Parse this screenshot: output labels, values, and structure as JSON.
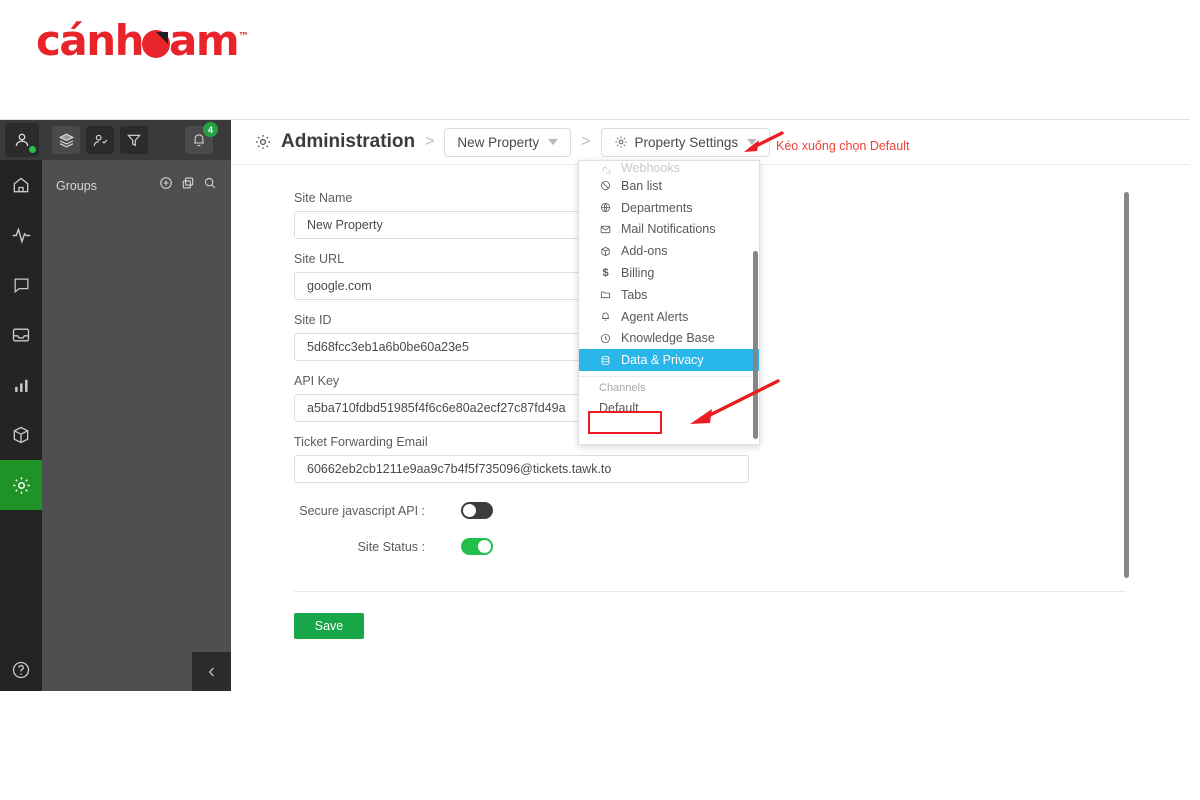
{
  "brand": {
    "text_before": "cánh",
    "text_after": "am",
    "trademark": "™"
  },
  "rail": {
    "avatar_icon": "user-avatar-icon",
    "status": "online",
    "items": [
      {
        "icon": "home-icon",
        "name": "home"
      },
      {
        "icon": "activity-icon",
        "name": "monitoring"
      },
      {
        "icon": "chat-icon",
        "name": "chats"
      },
      {
        "icon": "inbox-icon",
        "name": "inbox"
      },
      {
        "icon": "bar-chart-icon",
        "name": "reporting"
      },
      {
        "icon": "box-icon",
        "name": "shortcuts"
      },
      {
        "icon": "gear-icon",
        "name": "administration",
        "active": true
      }
    ],
    "help_icon": "help-circle-icon"
  },
  "groups": {
    "toolbar": [
      {
        "icon": "layers-icon",
        "name": "layers"
      },
      {
        "icon": "add-user-icon",
        "name": "add-user"
      },
      {
        "icon": "filter-icon",
        "name": "filter"
      }
    ],
    "bell_icon": "bell-icon",
    "bell_badge": "4",
    "title": "Groups",
    "actions": [
      {
        "icon": "plus-circle-icon",
        "name": "add-group"
      },
      {
        "icon": "copy-icon",
        "name": "duplicate"
      },
      {
        "icon": "search-icon",
        "name": "search"
      }
    ],
    "collapse_icon": "chevron-left-icon"
  },
  "breadcrumb": {
    "gear_icon": "gear-icon",
    "title": "Administration",
    "separator": ">",
    "property": "New Property",
    "settings_gear_icon": "gear-icon",
    "settings": "Property Settings"
  },
  "annotation": {
    "text": "Kéo xuống chọn Default",
    "color": "#ef4136"
  },
  "form": {
    "fields": [
      {
        "label": "Site Name",
        "value": "New  Property"
      },
      {
        "label": "Site URL",
        "value": "google.com"
      },
      {
        "label": "Site ID",
        "value": "5d68fcc3eb1a6b0be60a23e5"
      },
      {
        "label": "API Key",
        "value": "a5ba710fdbd51985f4f6c6e80a2ecf27c87fd49a"
      },
      {
        "label": "Ticket Forwarding Email",
        "value": "60662eb2cb1211e9aa9c7b4f5f735096@tickets.tawk.to"
      }
    ],
    "toggles": [
      {
        "label": "Secure javascript API :",
        "state": "off"
      },
      {
        "label": "Site Status :",
        "state": "on"
      }
    ],
    "save_label": "Save",
    "save_color": "#17a648"
  },
  "menu": {
    "items": [
      {
        "label": "Webhooks",
        "icon": "webhook-icon",
        "clipped": true
      },
      {
        "label": "Ban list",
        "icon": "ban-icon"
      },
      {
        "label": "Departments",
        "icon": "globe-icon"
      },
      {
        "label": "Mail Notifications",
        "icon": "mail-icon"
      },
      {
        "label": "Add-ons",
        "icon": "package-icon"
      },
      {
        "label": "Billing",
        "icon": "dollar-icon"
      },
      {
        "label": "Tabs",
        "icon": "folder-icon"
      },
      {
        "label": "Agent Alerts",
        "icon": "bell-icon"
      },
      {
        "label": "Knowledge Base",
        "icon": "clock-icon"
      },
      {
        "label": "Data & Privacy",
        "icon": "database-icon",
        "active": true
      }
    ],
    "section_label": "Channels",
    "channel": "Default",
    "active_color": "#29b6e8",
    "highlight_color": "#ed1c24"
  }
}
